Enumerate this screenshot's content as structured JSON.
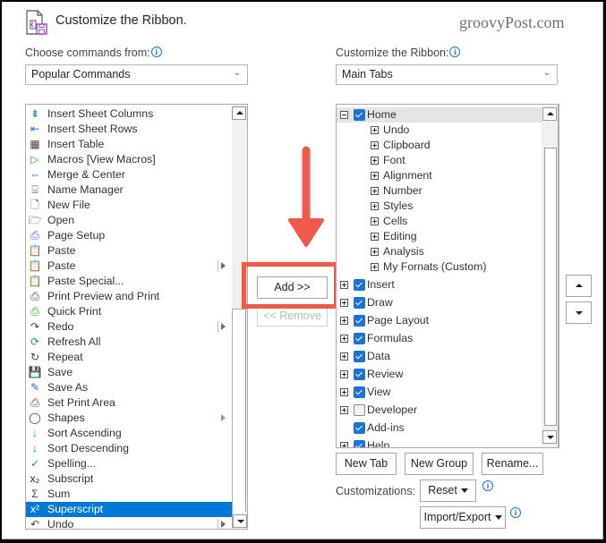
{
  "header": {
    "title": "Customize the Ribbon.",
    "watermark": "groovyPost.com"
  },
  "left": {
    "label": "Choose commands from:",
    "dropdown_value": "Popular Commands",
    "commands": [
      {
        "label": "Insert Sheet Columns",
        "icon": "insert-sheet-columns-icon",
        "glyph": "⇟",
        "color": "#1a73d9"
      },
      {
        "label": "Insert Sheet Rows",
        "icon": "insert-sheet-rows-icon",
        "glyph": "⇤",
        "color": "#1a73d9"
      },
      {
        "label": "Insert Table",
        "icon": "insert-table-icon",
        "glyph": "▦",
        "color": "#444"
      },
      {
        "label": "Macros [View Macros]",
        "icon": "macros-play-icon",
        "glyph": "▷",
        "color": "#2ca02c"
      },
      {
        "label": "Merge & Center",
        "icon": "merge-center-icon",
        "glyph": "⇔",
        "color": "#1a73d9"
      },
      {
        "label": "Name Manager",
        "icon": "name-manager-icon",
        "glyph": "⌺",
        "color": "#444"
      },
      {
        "label": "New File",
        "icon": "new-file-icon",
        "glyph": "🗋",
        "color": "#444"
      },
      {
        "label": "Open",
        "icon": "open-folder-icon",
        "glyph": "🗁",
        "color": "#444"
      },
      {
        "label": "Page Setup",
        "icon": "page-setup-icon",
        "glyph": "⎙",
        "color": "#1a73d9"
      },
      {
        "label": "Paste",
        "icon": "paste-icon",
        "glyph": "📋",
        "color": "#e08a1e"
      },
      {
        "label": "Paste",
        "icon": "paste-icon",
        "glyph": "📋",
        "color": "#e08a1e",
        "submenu": true
      },
      {
        "label": "Paste Special...",
        "icon": "paste-special-icon",
        "glyph": "📋",
        "color": "#e08a1e"
      },
      {
        "label": "Print Preview and Print",
        "icon": "print-preview-icon",
        "glyph": "⎙",
        "color": "#444"
      },
      {
        "label": "Quick Print",
        "icon": "quick-print-icon",
        "glyph": "⎙",
        "color": "#2ca02c"
      },
      {
        "label": "Redo",
        "icon": "redo-icon",
        "glyph": "↷",
        "color": "#444",
        "submenu": true
      },
      {
        "label": "Refresh All",
        "icon": "refresh-all-icon",
        "glyph": "⟳",
        "color": "#2ca02c"
      },
      {
        "label": "Repeat",
        "icon": "repeat-icon",
        "glyph": "↻",
        "color": "#444"
      },
      {
        "label": "Save",
        "icon": "save-icon",
        "glyph": "💾",
        "color": "#9b3fb5"
      },
      {
        "label": "Save As",
        "icon": "save-as-icon",
        "glyph": "✎",
        "color": "#1a73d9"
      },
      {
        "label": "Set Print Area",
        "icon": "set-print-area-icon",
        "glyph": "⎙",
        "color": "#444"
      },
      {
        "label": "Shapes",
        "icon": "shapes-icon",
        "glyph": "◯",
        "color": "#444",
        "submenu_gray": true
      },
      {
        "label": "Sort Ascending",
        "icon": "sort-ascending-icon",
        "glyph": "↓",
        "color": "#1a73d9"
      },
      {
        "label": "Sort Descending",
        "icon": "sort-descending-icon",
        "glyph": "↓",
        "color": "#1a73d9"
      },
      {
        "label": "Spelling...",
        "icon": "spelling-icon",
        "glyph": "✓",
        "color": "#2ca02c"
      },
      {
        "label": "Subscript",
        "icon": "subscript-icon",
        "glyph": "x₂",
        "color": "#222"
      },
      {
        "label": "Sum",
        "icon": "sum-icon",
        "glyph": "Σ",
        "color": "#444"
      },
      {
        "label": "Superscript",
        "icon": "superscript-icon",
        "glyph": "x²",
        "color": "#fff",
        "selected": true
      },
      {
        "label": "Undo",
        "icon": "undo-icon",
        "glyph": "↶",
        "color": "#444",
        "submenu": true
      }
    ]
  },
  "middle": {
    "add_label": "Add >>",
    "remove_label": "<< Remove",
    "annotation_color": "#f05a4a"
  },
  "right": {
    "label": "Customize the Ribbon:",
    "dropdown_value": "Main Tabs",
    "tree": [
      {
        "label": "Home",
        "level": 0,
        "expander": "minus",
        "checkbox": "checked",
        "selected": true
      },
      {
        "label": "Undo",
        "level": 1,
        "expander": "plus"
      },
      {
        "label": "Clipboard",
        "level": 1,
        "expander": "plus"
      },
      {
        "label": "Font",
        "level": 1,
        "expander": "plus"
      },
      {
        "label": "Alignment",
        "level": 1,
        "expander": "plus"
      },
      {
        "label": "Number",
        "level": 1,
        "expander": "plus"
      },
      {
        "label": "Styles",
        "level": 1,
        "expander": "plus"
      },
      {
        "label": "Cells",
        "level": 1,
        "expander": "plus"
      },
      {
        "label": "Editing",
        "level": 1,
        "expander": "plus"
      },
      {
        "label": "Analysis",
        "level": 1,
        "expander": "plus"
      },
      {
        "label": "My Fornats (Custom)",
        "level": 1,
        "expander": "plus"
      },
      {
        "label": "Insert",
        "level": 0,
        "expander": "plus",
        "checkbox": "checked"
      },
      {
        "label": "Draw",
        "level": 0,
        "expander": "plus",
        "checkbox": "checked"
      },
      {
        "label": "Page Layout",
        "level": 0,
        "expander": "plus",
        "checkbox": "checked"
      },
      {
        "label": "Formulas",
        "level": 0,
        "expander": "plus",
        "checkbox": "checked"
      },
      {
        "label": "Data",
        "level": 0,
        "expander": "plus",
        "checkbox": "checked"
      },
      {
        "label": "Review",
        "level": 0,
        "expander": "plus",
        "checkbox": "checked"
      },
      {
        "label": "View",
        "level": 0,
        "expander": "plus",
        "checkbox": "checked"
      },
      {
        "label": "Developer",
        "level": 0,
        "expander": "plus",
        "checkbox": "unchecked"
      },
      {
        "label": "Add-ins",
        "level": 0,
        "expander": "none",
        "checkbox": "checked"
      },
      {
        "label": "Help",
        "level": 0,
        "expander": "plus",
        "checkbox": "checked"
      }
    ],
    "new_tab_label": "New Tab",
    "new_group_label": "New Group",
    "rename_label": "Rename...",
    "customizations_label": "Customizations:",
    "reset_label": "Reset",
    "import_export_label": "Import/Export"
  }
}
